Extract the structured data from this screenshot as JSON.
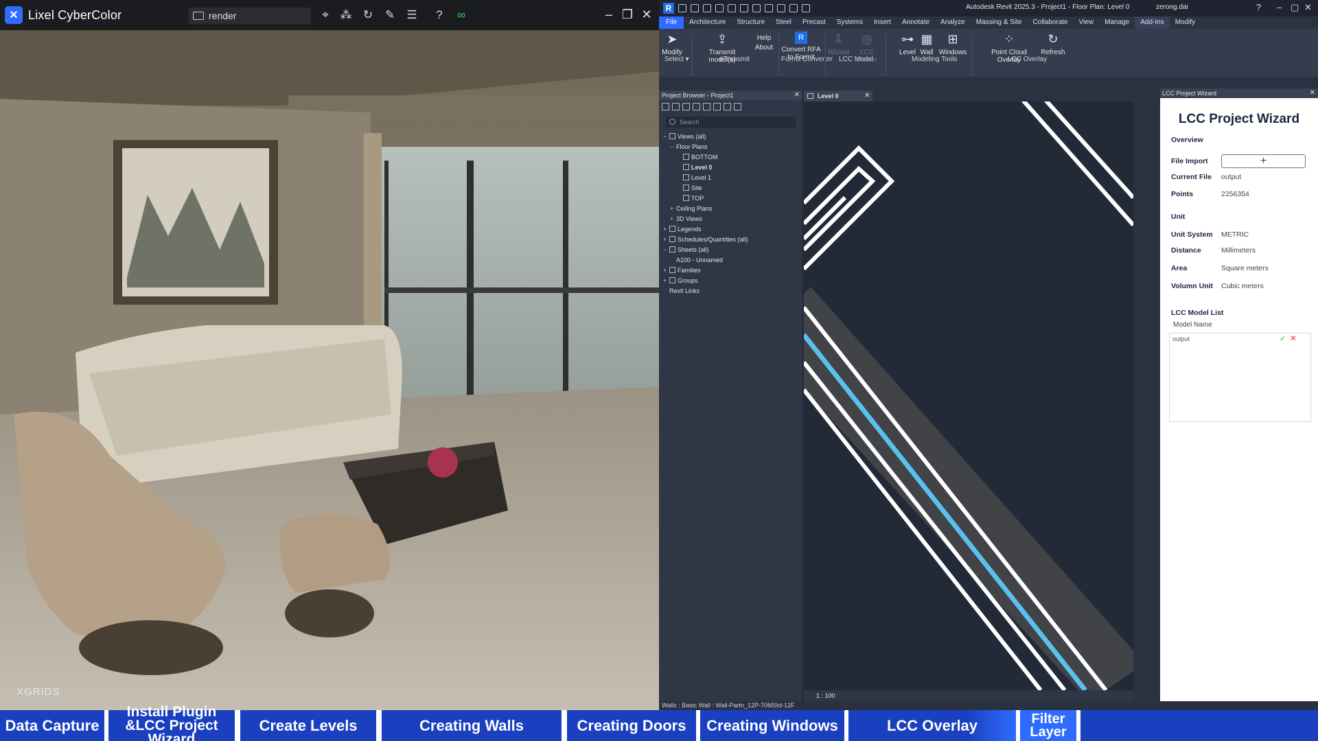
{
  "lixel": {
    "app_name": "Lixel CyberColor",
    "project_name": "render",
    "watermark": "XGRIDS",
    "toolbar_icons": [
      "location-pin-icon",
      "point-cloud-icon",
      "refresh-icon",
      "edit-icon",
      "list-icon",
      "help-icon",
      "link-icon"
    ]
  },
  "revit": {
    "window_title": "Autodesk Revit 2025.3 - Project1 - Floor Plan: Level 0",
    "user": "zerong.dai",
    "tabs": [
      "File",
      "Architecture",
      "Structure",
      "Steel",
      "Precast",
      "Systems",
      "Insert",
      "Annotate",
      "Analyze",
      "Massing & Site",
      "Collaborate",
      "View",
      "Manage",
      "Add-Ins",
      "Modify"
    ],
    "active_tab": "Add-Ins",
    "ribbon": {
      "modify": "Modify",
      "select": "Select ▾",
      "transmit": "Transmit model(s)",
      "help": "Help",
      "about": "About",
      "etransmit": "eTransmit",
      "convert": "Convert RFA to Formit",
      "formit": "Formit Converter",
      "wizard": "Wizard",
      "lcc_viewer": "LCC Viewer",
      "lcc_model": "LCC Model",
      "level": "Level",
      "wall": "Wall",
      "windows": "Windows",
      "modeling_tools": "Modeling Tools",
      "point_cloud_overlay": "Point Cloud Overlay",
      "refresh": "Refresh",
      "lcc_overlay": "LCC Overlay"
    },
    "project_browser": {
      "title": "Project Browser - Project1",
      "search_placeholder": "Search",
      "tree": [
        {
          "label": "Views (all)",
          "level": 0,
          "exp": "−",
          "icon": true
        },
        {
          "label": "Floor Plans",
          "level": 1,
          "exp": "−",
          "icon": false
        },
        {
          "label": "BOTTOM",
          "level": 2,
          "exp": "",
          "icon": true
        },
        {
          "label": "Level 0",
          "level": 2,
          "exp": "",
          "icon": true,
          "bold": true
        },
        {
          "label": "Level 1",
          "level": 2,
          "exp": "",
          "icon": true
        },
        {
          "label": "Site",
          "level": 2,
          "exp": "",
          "icon": true
        },
        {
          "label": "TOP",
          "level": 2,
          "exp": "",
          "icon": true
        },
        {
          "label": "Ceiling Plans",
          "level": 1,
          "exp": "+",
          "icon": false
        },
        {
          "label": "3D Views",
          "level": 1,
          "exp": "+",
          "icon": false
        },
        {
          "label": "Legends",
          "level": 0,
          "exp": "+",
          "icon": true
        },
        {
          "label": "Schedules/Quantities (all)",
          "level": 0,
          "exp": "+",
          "icon": true
        },
        {
          "label": "Sheets (all)",
          "level": 0,
          "exp": "−",
          "icon": true
        },
        {
          "label": "A100 - Unnamed",
          "level": 1,
          "exp": "",
          "icon": false
        },
        {
          "label": "Families",
          "level": 0,
          "exp": "+",
          "icon": true
        },
        {
          "label": "Groups",
          "level": 0,
          "exp": "+",
          "icon": true
        },
        {
          "label": "Revit Links",
          "level": 0,
          "exp": "",
          "icon": false
        }
      ]
    },
    "view_tab": "Level 0",
    "scale": "1 : 100",
    "status": "Walls : Basic Wall : Wall-Partn_12P-70MStd-12F",
    "wizard_panel": {
      "header": "LCC Project Wizard",
      "title": "LCC Project Wizard",
      "overview": "Overview",
      "file_import_label": "File Import",
      "file_import_btn": "+",
      "current_file_label": "Current File",
      "current_file": "output",
      "points_label": "Points",
      "points": "2256354",
      "unit": "Unit",
      "unit_system_label": "Unit System",
      "unit_system": "METRIC",
      "distance_label": "Distance",
      "distance": "Millimeters",
      "area_label": "Area",
      "area": "Square meters",
      "volume_label": "Volumn Unit",
      "volume": "Cubic meters",
      "model_list_label": "LCC Model List",
      "model_name_header": "Model Name",
      "model_item": "output",
      "check": "✓",
      "remove": "✕"
    }
  },
  "steps": [
    {
      "label": "Data Capture"
    },
    {
      "label": "Install Plugin &LCC Project Wizard"
    },
    {
      "label": "Create Levels"
    },
    {
      "label": "Creating Walls"
    },
    {
      "label": "Creating Doors"
    },
    {
      "label": "Creating Windows"
    },
    {
      "label": "LCC Overlay",
      "active": true
    },
    {
      "label": "Filter Layer"
    }
  ],
  "colors": {
    "step_bg": "#1a3fbf",
    "accent": "#2f6bff",
    "wall_blue": "#5bc0eb"
  }
}
